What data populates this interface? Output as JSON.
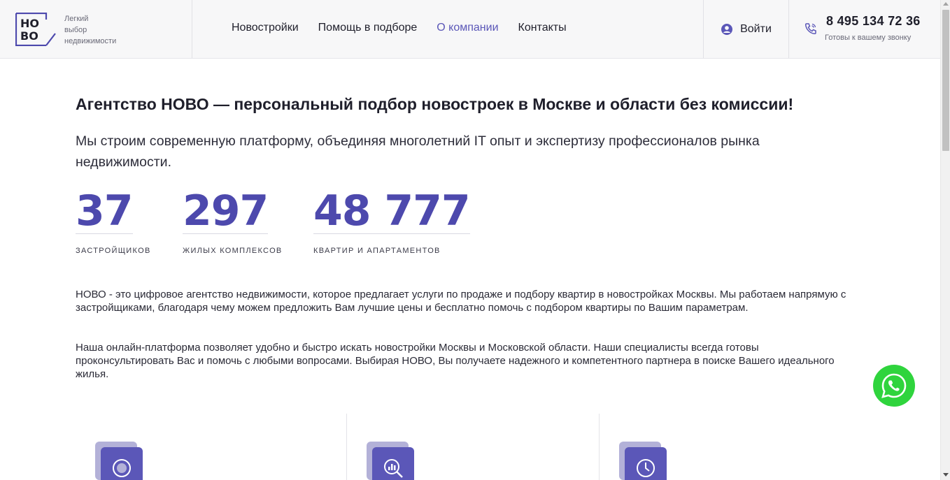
{
  "header": {
    "logo": {
      "mark_text": "НО ВО",
      "tagline": [
        "Легкий",
        "выбор",
        "недвижимости"
      ]
    },
    "nav": [
      {
        "label": "Новостройки",
        "active": false
      },
      {
        "label": "Помощь в подборе",
        "active": false
      },
      {
        "label": "О компании",
        "active": true
      },
      {
        "label": "Контакты",
        "active": false
      }
    ],
    "login_label": "Войти",
    "phone": {
      "number": "8 495 134 72 36",
      "subtitle": "Готовы к вашему звонку"
    }
  },
  "main": {
    "headline": "Агентство НОВО — персональный подбор новостроек в Москве и области без комиссии!",
    "subtitle": "Мы строим современную платформу, объединяя многолетний IT опыт и экспертизу профессионалов рынка недвижимости.",
    "stats": [
      {
        "value": "37",
        "label": "ЗАСТРОЙЩИКОВ"
      },
      {
        "value": "297",
        "label": "ЖИЛЫХ КОМПЛЕКСОВ"
      },
      {
        "value": "48 777",
        "label": "КВАРТИР И АПАРТАМЕНТОВ"
      }
    ],
    "paragraphs": [
      "НОВО - это цифровое агентство недвижимости, которое предлагает услуги по продаже и подбору квартир в новостройках Москвы. Мы работаем напрямую с застройщиками, благодаря чему можем предложить Вам лучшие цены и бесплатно помочь с подбором квартиры по Вашим параметрам.",
      "Наша онлайн-платформа позволяет удобно и быстро искать новостройки Москвы и Московской области. Наши специалисты всегда готовы проконсультировать Вас и помочь с любыми вопросами. Выбирая НОВО, Вы получаете надежного и компетентного партнера в поиске Вашего идеального жилья."
    ],
    "features": [
      {
        "icon": "target-icon"
      },
      {
        "icon": "search-chart-icon"
      },
      {
        "icon": "clock-icon"
      }
    ]
  },
  "colors": {
    "accent": "#5b57b8",
    "stat_number": "#4d49ad",
    "whatsapp": "#2fd43d"
  }
}
